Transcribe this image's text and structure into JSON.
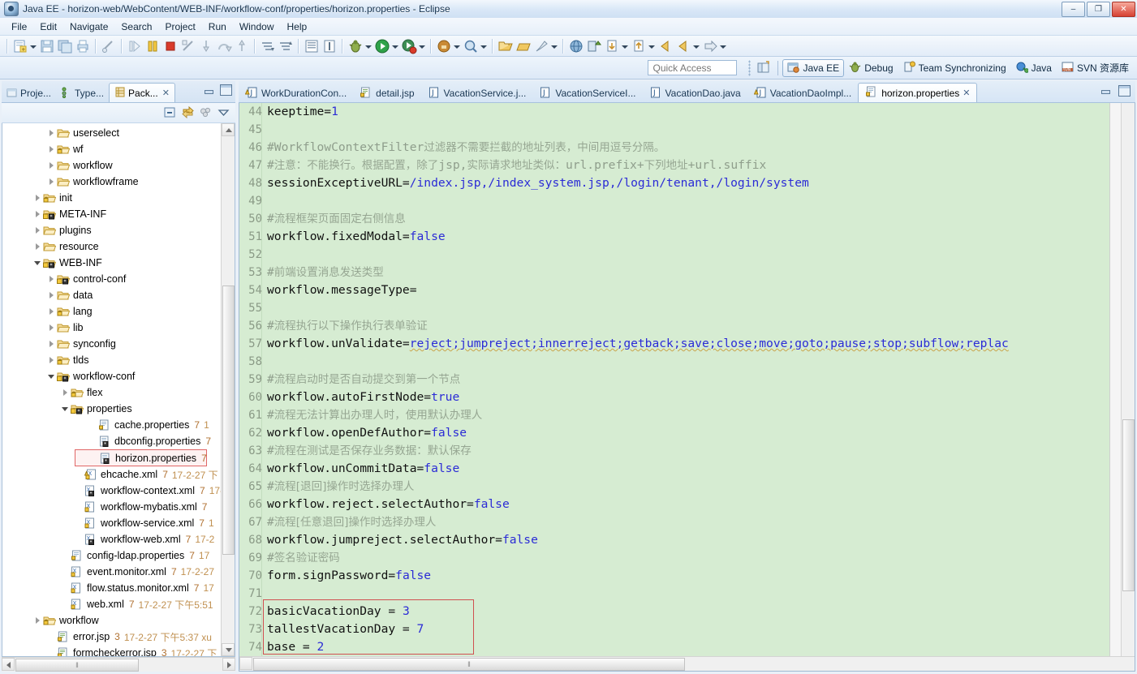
{
  "window": {
    "title": "Java EE - horizon-web/WebContent/WEB-INF/workflow-conf/properties/horizon.properties - Eclipse",
    "minimize_label": "–",
    "maximize_label": "❐",
    "close_label": "✕"
  },
  "menubar": {
    "items": [
      "File",
      "Edit",
      "Navigate",
      "Search",
      "Project",
      "Run",
      "Window",
      "Help"
    ]
  },
  "perspective_bar": {
    "quick_access_placeholder": "Quick Access",
    "open_perspective_icon": "open-perspective-icon",
    "perspectives": [
      {
        "label": "Java EE",
        "icon": "java-ee-perspective-icon",
        "active": true
      },
      {
        "label": "Debug",
        "icon": "debug-perspective-icon",
        "active": false
      },
      {
        "label": "Team Synchronizing",
        "icon": "team-sync-perspective-icon",
        "active": false
      },
      {
        "label": "Java",
        "icon": "java-perspective-icon",
        "active": false
      },
      {
        "label": "SVN 资源库",
        "icon": "svn-perspective-icon",
        "active": false
      }
    ]
  },
  "left_panel": {
    "tabs": [
      {
        "label": "Proje...",
        "icon": "project-explorer-icon",
        "active": false
      },
      {
        "label": "Type...",
        "icon": "type-hierarchy-icon",
        "active": false
      },
      {
        "label": "Pack...",
        "icon": "package-explorer-icon",
        "active": true,
        "close": "✕"
      }
    ],
    "view_toolbar": [
      "collapse-all-icon",
      "link-with-editor-icon",
      "focus-icon",
      "view-menu-icon"
    ],
    "tree": [
      {
        "indent": 3,
        "twist": "closed",
        "icon": "folder-icon",
        "label": "userselect",
        "meta": "",
        "meta2": ""
      },
      {
        "indent": 3,
        "twist": "closed",
        "icon": "folder-lock-icon",
        "label": "wf",
        "meta": "",
        "meta2": ""
      },
      {
        "indent": 3,
        "twist": "closed",
        "icon": "folder-icon",
        "label": "workflow",
        "meta": "",
        "meta2": ""
      },
      {
        "indent": 3,
        "twist": "closed",
        "icon": "folder-icon",
        "label": "workflowframe",
        "meta": "",
        "meta2": ""
      },
      {
        "indent": 2,
        "twist": "closed",
        "icon": "folder-lock-icon",
        "label": "init",
        "meta": "",
        "meta2": ""
      },
      {
        "indent": 2,
        "twist": "closed",
        "icon": "folder-star-icon",
        "label": "META-INF",
        "meta": "",
        "meta2": ""
      },
      {
        "indent": 2,
        "twist": "closed",
        "icon": "folder-icon",
        "label": "plugins",
        "meta": "",
        "meta2": ""
      },
      {
        "indent": 2,
        "twist": "closed",
        "icon": "folder-icon",
        "label": "resource",
        "meta": "",
        "meta2": ""
      },
      {
        "indent": 2,
        "twist": "open",
        "icon": "folder-star-icon",
        "label": "WEB-INF",
        "meta": "",
        "meta2": ""
      },
      {
        "indent": 3,
        "twist": "closed",
        "icon": "folder-star-icon",
        "label": "control-conf",
        "meta": "",
        "meta2": ""
      },
      {
        "indent": 3,
        "twist": "closed",
        "icon": "folder-icon",
        "label": "data",
        "meta": "",
        "meta2": ""
      },
      {
        "indent": 3,
        "twist": "closed",
        "icon": "folder-lock-icon",
        "label": "lang",
        "meta": "",
        "meta2": ""
      },
      {
        "indent": 3,
        "twist": "closed",
        "icon": "folder-icon",
        "label": "lib",
        "meta": "",
        "meta2": ""
      },
      {
        "indent": 3,
        "twist": "closed",
        "icon": "folder-icon",
        "label": "synconfig",
        "meta": "",
        "meta2": ""
      },
      {
        "indent": 3,
        "twist": "closed",
        "icon": "folder-lock-icon",
        "label": "tlds",
        "meta": "",
        "meta2": ""
      },
      {
        "indent": 3,
        "twist": "open",
        "icon": "folder-star-icon",
        "label": "workflow-conf",
        "meta": "",
        "meta2": ""
      },
      {
        "indent": 4,
        "twist": "closed",
        "icon": "folder-lock-icon",
        "label": "flex",
        "meta": "",
        "meta2": ""
      },
      {
        "indent": 4,
        "twist": "open",
        "icon": "folder-star-icon",
        "label": "properties",
        "meta": "",
        "meta2": ""
      },
      {
        "indent": 6,
        "twist": "none",
        "icon": "properties-file-icon",
        "label": "cache.properties",
        "meta": "7",
        "meta2": "1"
      },
      {
        "indent": 6,
        "twist": "none",
        "icon": "properties-file-star-icon",
        "label": "dbconfig.properties",
        "meta": "7",
        "meta2": ""
      },
      {
        "indent": 6,
        "twist": "none",
        "icon": "properties-file-star-icon",
        "label": "horizon.properties",
        "meta": "7",
        "meta2": "",
        "highlighted": true
      },
      {
        "indent": 5,
        "twist": "none",
        "icon": "xml-warn-file-icon",
        "label": "ehcache.xml",
        "meta": "7",
        "meta2": "17-2-27 下"
      },
      {
        "indent": 5,
        "twist": "none",
        "icon": "xml-file-star-icon",
        "label": "workflow-context.xml",
        "meta": "7",
        "meta2": "17-"
      },
      {
        "indent": 5,
        "twist": "none",
        "icon": "xml-file-icon",
        "label": "workflow-mybatis.xml",
        "meta": "7",
        "meta2": ""
      },
      {
        "indent": 5,
        "twist": "none",
        "icon": "xml-file-icon",
        "label": "workflow-service.xml",
        "meta": "7",
        "meta2": "1"
      },
      {
        "indent": 5,
        "twist": "none",
        "icon": "xml-file-star-icon",
        "label": "workflow-web.xml",
        "meta": "7",
        "meta2": "17-2"
      },
      {
        "indent": 4,
        "twist": "none",
        "icon": "properties-file-icon",
        "label": "config-ldap.properties",
        "meta": "7",
        "meta2": "17"
      },
      {
        "indent": 4,
        "twist": "none",
        "icon": "xml-file-icon",
        "label": "event.monitor.xml",
        "meta": "7",
        "meta2": "17-2-27"
      },
      {
        "indent": 4,
        "twist": "none",
        "icon": "xml-file-icon",
        "label": "flow.status.monitor.xml",
        "meta": "7",
        "meta2": "17"
      },
      {
        "indent": 4,
        "twist": "none",
        "icon": "xml-file-icon",
        "label": "web.xml",
        "meta": "7",
        "meta2": "17-2-27 下午5:51"
      },
      {
        "indent": 2,
        "twist": "closed",
        "icon": "folder-lock-icon",
        "label": "workflow",
        "meta": "",
        "meta2": ""
      },
      {
        "indent": 3,
        "twist": "none",
        "icon": "jsp-file-icon",
        "label": "error.jsp",
        "meta": "3",
        "meta2": "17-2-27 下午5:37  xu"
      },
      {
        "indent": 3,
        "twist": "none",
        "icon": "jsp-file-icon",
        "label": "formcheckerror.jsp",
        "meta": "3",
        "meta2": "17-2-27 下"
      }
    ],
    "hscroll_grip": "‖"
  },
  "editor_area": {
    "tabs": [
      {
        "label": "WorkDurationCon...",
        "icon": "java-warning-file-icon",
        "active": false
      },
      {
        "label": "detail.jsp",
        "icon": "jsp-file-icon",
        "active": false
      },
      {
        "label": "VacationService.j...",
        "icon": "java-file-icon",
        "active": false
      },
      {
        "label": "VacationServiceI...",
        "icon": "java-file-icon",
        "active": false
      },
      {
        "label": "VacationDao.java",
        "icon": "java-file-icon",
        "active": false
      },
      {
        "label": "VacationDaoImpl...",
        "icon": "java-warning-file-icon",
        "active": false
      },
      {
        "label": "horizon.properties",
        "icon": "properties-file-icon",
        "active": true,
        "close": "✕"
      }
    ],
    "controls": [
      "minimize-editor-icon",
      "maximize-editor-icon"
    ],
    "hscroll_grip": "‖",
    "highlight_box": {
      "color": "#d05050"
    },
    "lines": [
      {
        "num": "44",
        "parts": [
          {
            "t": "keeptime=",
            "c": "key"
          },
          {
            "t": "1",
            "c": "val"
          }
        ]
      },
      {
        "num": "45",
        "parts": []
      },
      {
        "num": "46",
        "parts": [
          {
            "t": "#WorkflowContextFilter",
            "c": "comment"
          },
          {
            "t": "过滤器不需要拦截的地址列表，中间用逗号分隔。",
            "c": "comment-cjk"
          }
        ]
      },
      {
        "num": "47",
        "parts": [
          {
            "t": "#",
            "c": "comment"
          },
          {
            "t": "注意：不能换行。根据配置，除了",
            "c": "comment-cjk"
          },
          {
            "t": "jsp",
            "c": "comment"
          },
          {
            "t": ",",
            "c": "comment"
          },
          {
            "t": "实际请求地址类似：",
            "c": "comment-cjk"
          },
          {
            "t": "url.prefix",
            "c": "comment"
          },
          {
            "t": "+",
            "c": "comment"
          },
          {
            "t": "下列地址",
            "c": "comment-cjk"
          },
          {
            "t": "+url.suffix",
            "c": "comment"
          }
        ]
      },
      {
        "num": "48",
        "parts": [
          {
            "t": "sessionExceptiveURL=",
            "c": "key"
          },
          {
            "t": "/index.jsp,/index_system.jsp,/login/tenant,/login/system",
            "c": "val"
          }
        ]
      },
      {
        "num": "49",
        "parts": []
      },
      {
        "num": "50",
        "parts": [
          {
            "t": "#",
            "c": "comment"
          },
          {
            "t": "流程框架页面固定右侧信息",
            "c": "comment-cjk"
          }
        ]
      },
      {
        "num": "51",
        "parts": [
          {
            "t": "workflow.fixedModal=",
            "c": "key"
          },
          {
            "t": "false",
            "c": "val"
          }
        ]
      },
      {
        "num": "52",
        "parts": []
      },
      {
        "num": "53",
        "parts": [
          {
            "t": "#",
            "c": "comment"
          },
          {
            "t": "前端设置消息发送类型",
            "c": "comment-cjk"
          }
        ]
      },
      {
        "num": "54",
        "parts": [
          {
            "t": "workflow.messageType=",
            "c": "key"
          }
        ]
      },
      {
        "num": "55",
        "parts": []
      },
      {
        "num": "56",
        "parts": [
          {
            "t": "#",
            "c": "comment"
          },
          {
            "t": "流程执行以下操作执行表单验证",
            "c": "comment-cjk"
          }
        ]
      },
      {
        "num": "57",
        "parts": [
          {
            "t": "workflow.unValidate=",
            "c": "key"
          },
          {
            "t": "reject;jumpreject;innerreject;getback;save;close;move;goto;pause;stop;subflow;replac",
            "c": "val-squig"
          }
        ]
      },
      {
        "num": "58",
        "parts": []
      },
      {
        "num": "59",
        "parts": [
          {
            "t": "#",
            "c": "comment"
          },
          {
            "t": "流程启动时是否自动提交到第一个节点",
            "c": "comment-cjk"
          }
        ]
      },
      {
        "num": "60",
        "parts": [
          {
            "t": "workflow.autoFirstNode=",
            "c": "key"
          },
          {
            "t": "true",
            "c": "val"
          }
        ]
      },
      {
        "num": "61",
        "parts": [
          {
            "t": "#",
            "c": "comment"
          },
          {
            "t": "流程无法计算出办理人时，使用默认办理人",
            "c": "comment-cjk"
          }
        ]
      },
      {
        "num": "62",
        "parts": [
          {
            "t": "workflow.openDefAuthor=",
            "c": "key"
          },
          {
            "t": "false",
            "c": "val"
          }
        ]
      },
      {
        "num": "63",
        "parts": [
          {
            "t": "#",
            "c": "comment"
          },
          {
            "t": "流程在测试是否保存业务数据：默认保存",
            "c": "comment-cjk"
          }
        ]
      },
      {
        "num": "64",
        "parts": [
          {
            "t": "workflow.unCommitData=",
            "c": "key"
          },
          {
            "t": "false",
            "c": "val"
          }
        ]
      },
      {
        "num": "65",
        "parts": [
          {
            "t": "#",
            "c": "comment"
          },
          {
            "t": "流程[退回]操作时选择办理人",
            "c": "comment-cjk"
          }
        ]
      },
      {
        "num": "66",
        "parts": [
          {
            "t": "workflow.reject.selectAuthor=",
            "c": "key"
          },
          {
            "t": "false",
            "c": "val"
          }
        ]
      },
      {
        "num": "67",
        "parts": [
          {
            "t": "#",
            "c": "comment"
          },
          {
            "t": "流程[任意退回]操作时选择办理人",
            "c": "comment-cjk"
          }
        ]
      },
      {
        "num": "68",
        "parts": [
          {
            "t": "workflow.jumpreject.selectAuthor=",
            "c": "key"
          },
          {
            "t": "false",
            "c": "val"
          }
        ]
      },
      {
        "num": "69",
        "parts": [
          {
            "t": "#",
            "c": "comment"
          },
          {
            "t": "签名验证密码",
            "c": "comment-cjk"
          }
        ]
      },
      {
        "num": "70",
        "parts": [
          {
            "t": "form.signPassword=",
            "c": "key"
          },
          {
            "t": "false",
            "c": "val"
          }
        ]
      },
      {
        "num": "71",
        "parts": []
      },
      {
        "num": "72",
        "parts": [
          {
            "t": "basicVacationDay = ",
            "c": "key"
          },
          {
            "t": "3",
            "c": "val"
          }
        ]
      },
      {
        "num": "73",
        "parts": [
          {
            "t": "tallestVacationDay = ",
            "c": "key"
          },
          {
            "t": "7",
            "c": "val"
          }
        ]
      },
      {
        "num": "74",
        "parts": [
          {
            "t": "base = ",
            "c": "key"
          },
          {
            "t": "2",
            "c": "val"
          }
        ]
      }
    ]
  },
  "colors": {
    "editor_background": "#d6ecd2",
    "value_text": "#2b2bd6",
    "comment_text": "#8f9e8c",
    "highlight_border": "#d05050",
    "chrome_blue": "#d4e4f5"
  }
}
